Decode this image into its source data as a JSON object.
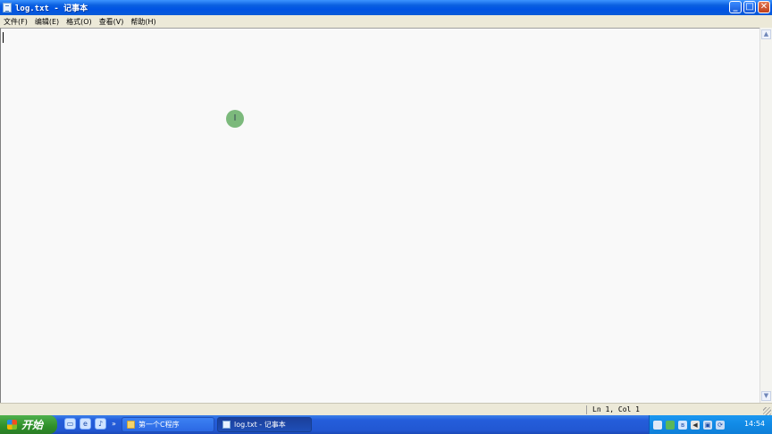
{
  "window": {
    "title": "log.txt - 记事本",
    "buttons": {
      "minimize": "_",
      "maximize": "□",
      "close": "✕"
    }
  },
  "menu": [
    {
      "label": "文件(F)"
    },
    {
      "label": "编辑(E)"
    },
    {
      "label": "格式(O)"
    },
    {
      "label": "查看(V)"
    },
    {
      "label": "帮助(H)"
    }
  ],
  "editor": {
    "content": ""
  },
  "status": {
    "position": "Ln 1, Col 1"
  },
  "taskbar": {
    "start_label": "开始",
    "quick_launch_more": "»",
    "tasks": [
      {
        "label": "第一个C程序",
        "icon": "folder-icon",
        "active": false
      },
      {
        "label": "log.txt - 记事本",
        "icon": "notepad-icon",
        "active": true
      }
    ],
    "clock": "14:54"
  },
  "colors": {
    "titlebar": "#0054e3",
    "taskbar": "#245edb",
    "start": "#2f8f2a",
    "tray": "#118ae6"
  }
}
